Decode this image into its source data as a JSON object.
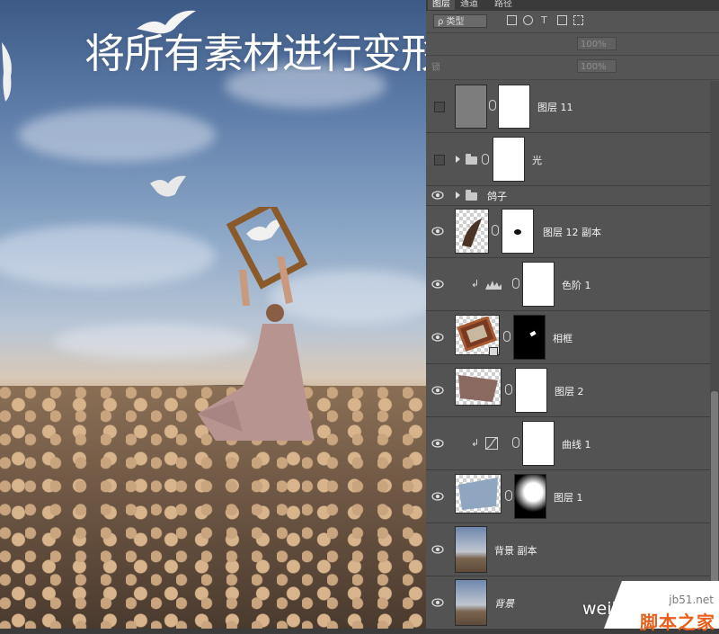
{
  "canvas": {
    "headline": "将所有素材进行变形并安置到位"
  },
  "panel": {
    "tabs": [
      "图层",
      "通道",
      "路径"
    ],
    "kind_select": "ρ 类型",
    "opacity_value": "100%",
    "fill_value": "100%",
    "lock_label": "锁"
  },
  "layers": [
    {
      "name": "图层 11",
      "visible": false,
      "type": "layer"
    },
    {
      "name": "光",
      "visible": false,
      "type": "group-thumb"
    },
    {
      "name": "鸽子",
      "visible": true,
      "type": "group"
    },
    {
      "name": "图层 12 副本",
      "visible": true,
      "type": "layer"
    },
    {
      "name": "色阶 1",
      "visible": true,
      "type": "adjustment"
    },
    {
      "name": "相框",
      "visible": true,
      "type": "layer"
    },
    {
      "name": "图层 2",
      "visible": true,
      "type": "layer"
    },
    {
      "name": "曲线 1",
      "visible": true,
      "type": "adjustment"
    },
    {
      "name": "图层 1",
      "visible": true,
      "type": "layer"
    },
    {
      "name": "背景 副本",
      "visible": true,
      "type": "layer"
    },
    {
      "name": "背景",
      "visible": true,
      "type": "layer"
    }
  ],
  "watermark": {
    "weibo": "weibo.com/u",
    "jb51_url": "jb51.net",
    "jb51_name": "脚本之家"
  },
  "colors": {
    "panel_bg": "#535353",
    "row_divider": "#3e3e3e",
    "text": "#f2f2f2",
    "jb51_orange": "#e8601c"
  }
}
